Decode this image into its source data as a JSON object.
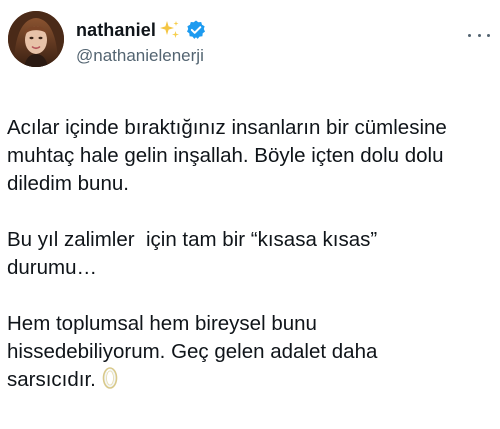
{
  "author": {
    "display_name": "nathaniel",
    "handle": "@nathanielenerji",
    "name_emoji": "sparkles-icon",
    "verified": true,
    "verified_color": "#1d9bf0"
  },
  "tweet": {
    "paragraphs": [
      {
        "lines": [
          "Acılar içinde bıraktığınız insanların bir cümlesine",
          "muhtaç hale gelin inşallah. Böyle içten dolu dolu",
          "diledim bunu."
        ]
      },
      {
        "lines": [
          "Bu yıl zalimler  için tam bir “kısasa kısas”",
          "durumu…"
        ]
      },
      {
        "lines": [
          "Hem toplumsal hem bireysel bunu",
          "hissedebiliyorum. Geç gelen adalet daha",
          "sarsıcıdır."
        ],
        "trailing_emoji": "gem-icon"
      }
    ]
  },
  "colors": {
    "text": "#0f1419",
    "secondary": "#536471",
    "verified": "#1d9bf0"
  }
}
